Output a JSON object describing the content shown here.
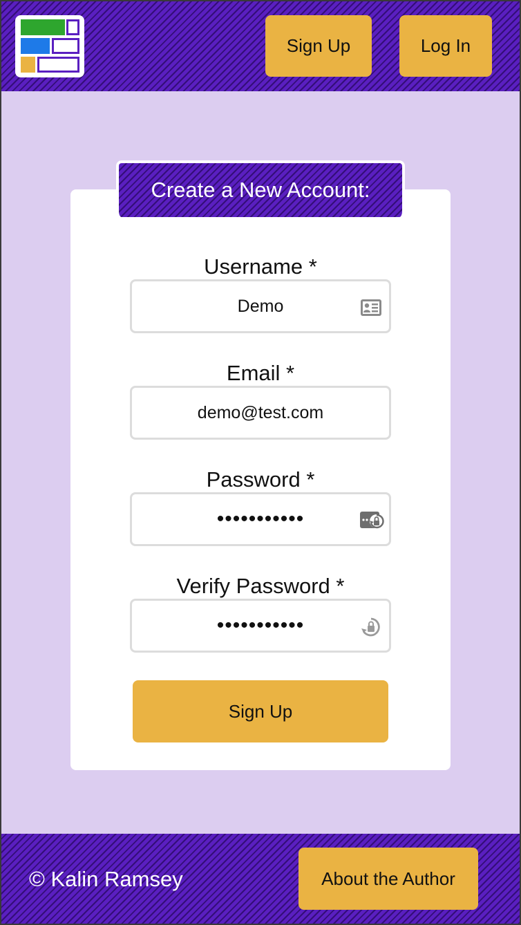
{
  "header": {
    "signup_label": "Sign Up",
    "login_label": "Log In"
  },
  "form": {
    "title": "Create a New Account:",
    "username": {
      "label": "Username *",
      "value": "Demo"
    },
    "email": {
      "label": "Email *",
      "value": "demo@test.com"
    },
    "password": {
      "label": "Password *",
      "value": "•••••••••••"
    },
    "verify_password": {
      "label": "Verify Password *",
      "value": "•••••••••••"
    },
    "submit_label": "Sign Up"
  },
  "footer": {
    "copyright": "© Kalin Ramsey",
    "about_label": "About the Author"
  },
  "icons": {
    "logo": "logo-icon",
    "username": "contact-card-icon",
    "password": "password-reset-icon",
    "verify_password": "lock-refresh-icon"
  },
  "colors": {
    "brand_purple": "#5a1fc0",
    "background": "#dccdf0",
    "button": "#eab343",
    "logo_green": "#2ea62e",
    "logo_blue": "#1e7ae8",
    "logo_yellow": "#eab343"
  }
}
